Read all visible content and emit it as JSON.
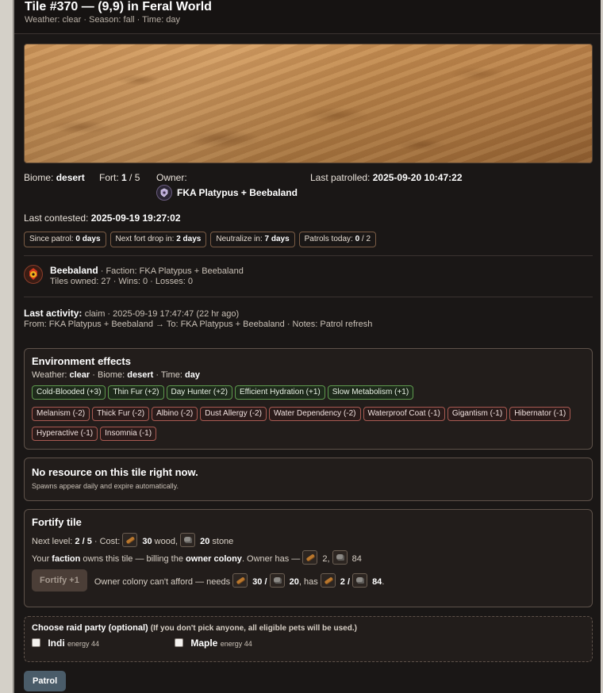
{
  "header": {
    "title": "Tile #370 — (9,9) in Feral World",
    "subtitle": "Weather: clear · Season: fall · Time: day"
  },
  "info": {
    "biome_label": "Biome:",
    "biome_value": "desert",
    "fort_label": "Fort:",
    "fort_value": "1",
    "fort_max": " / 5",
    "owner_label": "Owner:",
    "owner_name": "FKA Platypus + Beebaland",
    "last_patrolled_label": "Last patrolled:",
    "last_patrolled_value": "2025-09-20 10:47:22",
    "last_contested_label": "Last contested:",
    "last_contested_value": "2025-09-19 19:27:02"
  },
  "chips": {
    "since_patrol_label": "Since patrol:",
    "since_patrol_value": "0 days",
    "next_fort_label": "Next fort drop in:",
    "next_fort_value": "2 days",
    "neutralize_label": "Neutralize in:",
    "neutralize_value": "7 days",
    "patrols_label": "Patrols today:",
    "patrols_value": "0",
    "patrols_max": " / 2"
  },
  "colony": {
    "name": "Beebaland",
    "faction": " · Faction: FKA Platypus + Beebaland",
    "stats": "Tiles owned: 27 · Wins: 0 · Losses: 0"
  },
  "activity": {
    "label": "Last activity:",
    "meta": "claim · 2025-09-19 17:47:47 (22 hr ago)",
    "detail": "From: FKA Platypus + Beebaland → To: FKA Platypus + Beebaland · Notes: Patrol refresh"
  },
  "environment": {
    "title": "Environment effects",
    "weather_label": "Weather:",
    "weather_value": "clear",
    "biome_label": " · Biome:",
    "biome_value": "desert",
    "time_label": " · Time:",
    "time_value": "day",
    "positive": [
      "Cold-Blooded (+3)",
      "Thin Fur (+2)",
      "Day Hunter (+2)",
      "Efficient Hydration (+1)",
      "Slow Metabolism (+1)"
    ],
    "negative_row1": [
      "Melanism (-2)",
      "Thick Fur (-2)",
      "Albino (-2)",
      "Dust Allergy (-2)",
      "Water Dependency (-2)",
      "Waterproof Coat (-1)",
      "Gigantism (-1)",
      "Hibernator (-1)"
    ],
    "negative_row2": [
      "Hyperactive (-1)",
      "Insomnia (-1)"
    ]
  },
  "resource": {
    "title": "No resource on this tile right now.",
    "note": "Spawns appear daily and expire automatically."
  },
  "fortify": {
    "title": "Fortify tile",
    "next_level_label": "Next level:",
    "next_level_value": "2 / 5",
    "cost_label": " · Cost:",
    "wood_cost": "30",
    "wood_word": " wood,",
    "stone_cost": "20",
    "stone_word": " stone",
    "billing_a": "Your ",
    "billing_faction": "faction",
    "billing_b": " owns this tile — billing the ",
    "billing_owner": "owner colony",
    "billing_c": ". Owner has —",
    "owner_wood": "2,",
    "owner_stone": "84",
    "button_label": "Fortify +1",
    "afford_text": "Owner colony can't afford — needs",
    "need_wood": "30 /",
    "need_stone": "20",
    "has_text": ", has",
    "has_wood": "2 /",
    "has_stone": "84",
    "icons": {
      "wood": "wood-icon",
      "stone": "stone-icon"
    }
  },
  "raid": {
    "title": "Choose raid party (optional)",
    "hint": "(If you don't pick anyone, all eligible pets will be used.)",
    "pets": [
      {
        "name": "Indi",
        "energy": "energy 44"
      },
      {
        "name": "Maple",
        "energy": "energy 44"
      }
    ]
  },
  "patrol_button": "Patrol"
}
